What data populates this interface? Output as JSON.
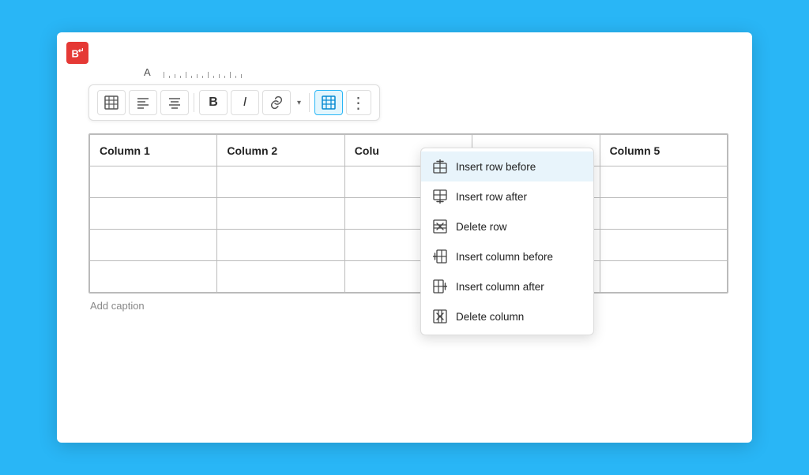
{
  "brand": {
    "label": "B↵"
  },
  "toolbar": {
    "buttons": [
      {
        "id": "table",
        "label": "⊞",
        "type": "icon",
        "active": false
      },
      {
        "id": "align-left",
        "label": "≡",
        "type": "icon",
        "active": false
      },
      {
        "id": "align-center",
        "label": "≡",
        "type": "icon",
        "active": false
      },
      {
        "id": "bold",
        "label": "B",
        "type": "bold",
        "active": false
      },
      {
        "id": "italic",
        "label": "I",
        "type": "italic",
        "active": false
      },
      {
        "id": "link",
        "label": "⊙",
        "type": "icon",
        "active": false
      },
      {
        "id": "table-active",
        "label": "⊞",
        "type": "icon",
        "active": true
      }
    ],
    "more_label": "⋮"
  },
  "table": {
    "headers": [
      "Column 1",
      "Column 2",
      "Colu",
      "",
      "Column 5"
    ],
    "rows": [
      [
        "",
        "",
        "",
        "",
        ""
      ],
      [
        "",
        "",
        "",
        "",
        ""
      ],
      [
        "",
        "",
        "",
        "",
        ""
      ],
      [
        "",
        "",
        "",
        "",
        ""
      ]
    ],
    "caption": "Add caption"
  },
  "context_menu": {
    "items": [
      {
        "id": "insert-row-before",
        "label": "Insert row before",
        "highlighted": true
      },
      {
        "id": "insert-row-after",
        "label": "Insert row after",
        "highlighted": false
      },
      {
        "id": "delete-row",
        "label": "Delete row",
        "highlighted": false
      },
      {
        "id": "insert-col-before",
        "label": "Insert column before",
        "highlighted": false
      },
      {
        "id": "insert-col-after",
        "label": "Insert column after",
        "highlighted": false
      },
      {
        "id": "delete-col",
        "label": "Delete column",
        "highlighted": false
      }
    ]
  }
}
